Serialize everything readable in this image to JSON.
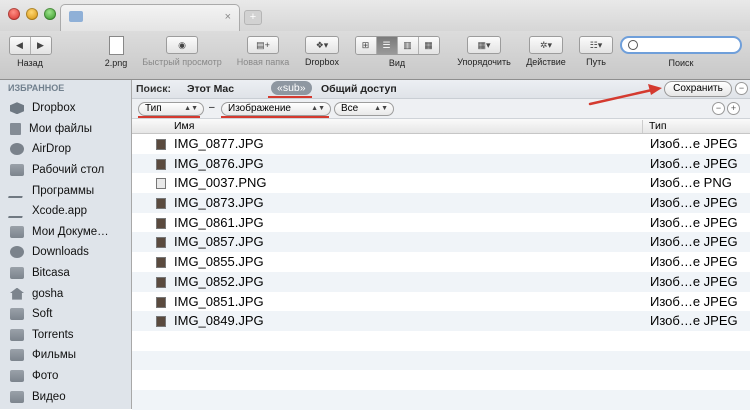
{
  "window": {
    "tab_close": "×",
    "tab_add": "+"
  },
  "toolbar": {
    "back_label": "Назад",
    "file_label": "2.png",
    "quicklook_label": "Быстрый просмотр",
    "newfolder_label": "Новая папка",
    "dropbox_label": "Dropbox",
    "view_label": "Вид",
    "arrange_label": "Упорядочить",
    "action_label": "Действие",
    "path_label": "Путь",
    "search_label": "Поиск"
  },
  "sidebar": {
    "heading": "ИЗБРАННОЕ",
    "items": [
      {
        "label": "Dropbox",
        "icon": "dropbox-icon"
      },
      {
        "label": "Мои файлы",
        "icon": "all-files-icon"
      },
      {
        "label": "AirDrop",
        "icon": "airdrop-icon"
      },
      {
        "label": "Рабочий стол",
        "icon": "desktop-icon"
      },
      {
        "label": "Программы",
        "icon": "applications-icon"
      },
      {
        "label": "Xcode.app",
        "icon": "xcode-icon"
      },
      {
        "label": "Мои Докуме…",
        "icon": "folder-icon"
      },
      {
        "label": "Downloads",
        "icon": "downloads-icon"
      },
      {
        "label": "Bitcasa",
        "icon": "folder-icon"
      },
      {
        "label": "gosha",
        "icon": "home-icon"
      },
      {
        "label": "Soft",
        "icon": "folder-icon"
      },
      {
        "label": "Torrents",
        "icon": "folder-icon"
      },
      {
        "label": "Фильмы",
        "icon": "folder-icon"
      },
      {
        "label": "Фото",
        "icon": "folder-icon"
      },
      {
        "label": "Видео",
        "icon": "folder-icon"
      }
    ]
  },
  "scope": {
    "search_label": "Поиск:",
    "this_mac": "Этот Mac",
    "sub": "«sub»",
    "shared": "Общий доступ",
    "save": "Сохранить",
    "remove": "−"
  },
  "criteria": {
    "kind": "Тип",
    "dash": "–",
    "value": "Изображение",
    "scope": "Все",
    "remove": "−",
    "add": "+"
  },
  "columns": {
    "name": "Имя",
    "type": "Тип"
  },
  "files": [
    {
      "name": "IMG_0877.JPG",
      "type": "Изоб…е JPEG"
    },
    {
      "name": "IMG_0876.JPG",
      "type": "Изоб…е JPEG"
    },
    {
      "name": "IMG_0037.PNG",
      "type": "Изоб…е PNG"
    },
    {
      "name": "IMG_0873.JPG",
      "type": "Изоб…е JPEG"
    },
    {
      "name": "IMG_0861.JPG",
      "type": "Изоб…е JPEG"
    },
    {
      "name": "IMG_0857.JPG",
      "type": "Изоб…е JPEG"
    },
    {
      "name": "IMG_0855.JPG",
      "type": "Изоб…е JPEG"
    },
    {
      "name": "IMG_0852.JPG",
      "type": "Изоб…е JPEG"
    },
    {
      "name": "IMG_0851.JPG",
      "type": "Изоб…е JPEG"
    },
    {
      "name": "IMG_0849.JPG",
      "type": "Изоб…е JPEG"
    }
  ],
  "colors": {
    "annotation_red": "#d43a2f",
    "search_ring": "#6f9fda"
  }
}
